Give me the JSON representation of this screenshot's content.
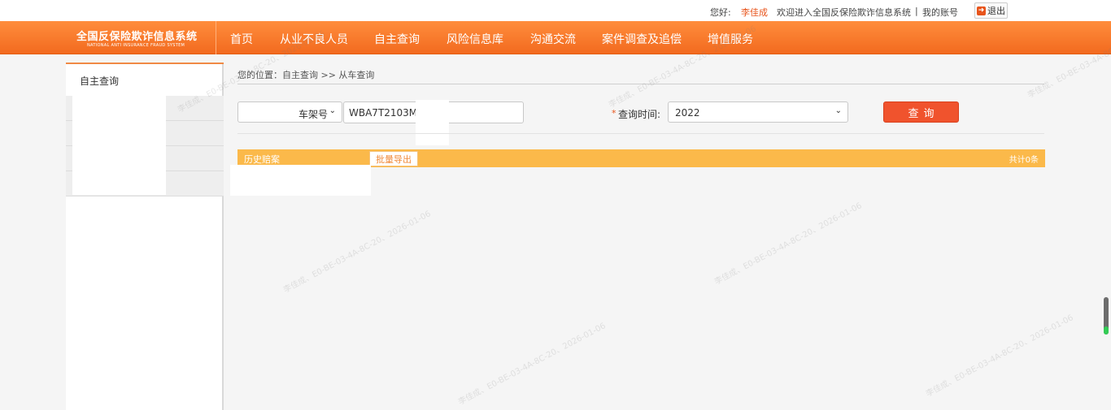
{
  "userbar": {
    "greeting": "您好:",
    "username": "李佳成",
    "welcome": "欢迎进入全国反保险欺诈信息系统",
    "separator": "|",
    "my_account": "我的账号",
    "logout": "退出"
  },
  "logo": {
    "cn": "全国反保险欺诈信息系统",
    "en": "NATIONAL ANTI INSURANCE FRAUD SYSTEM"
  },
  "nav": {
    "items": [
      "首页",
      "从业不良人员",
      "自主查询",
      "风险信息库",
      "沟通交流",
      "案件调查及追偿",
      "增值服务"
    ]
  },
  "sidebar": {
    "title": "自主查询"
  },
  "breadcrumb": "您的位置：自主查询 >> 从车查询",
  "form": {
    "field_type": "车架号",
    "vin_value": "WBA7T2103MC",
    "time_label": "查询时间:",
    "time_value": "2022",
    "query_label": "查询"
  },
  "results": {
    "title": "历史赔案",
    "export_label": "批量导出",
    "count_text": "共计0条"
  },
  "watermark": {
    "text": "李佳成、E0-BE-03-4A-8C-20、2026-01-06"
  },
  "colors": {
    "nav_orange": "#f47a2c",
    "accent_red": "#f0532d",
    "result_bar": "#fbb94a",
    "username": "#e8541b"
  }
}
